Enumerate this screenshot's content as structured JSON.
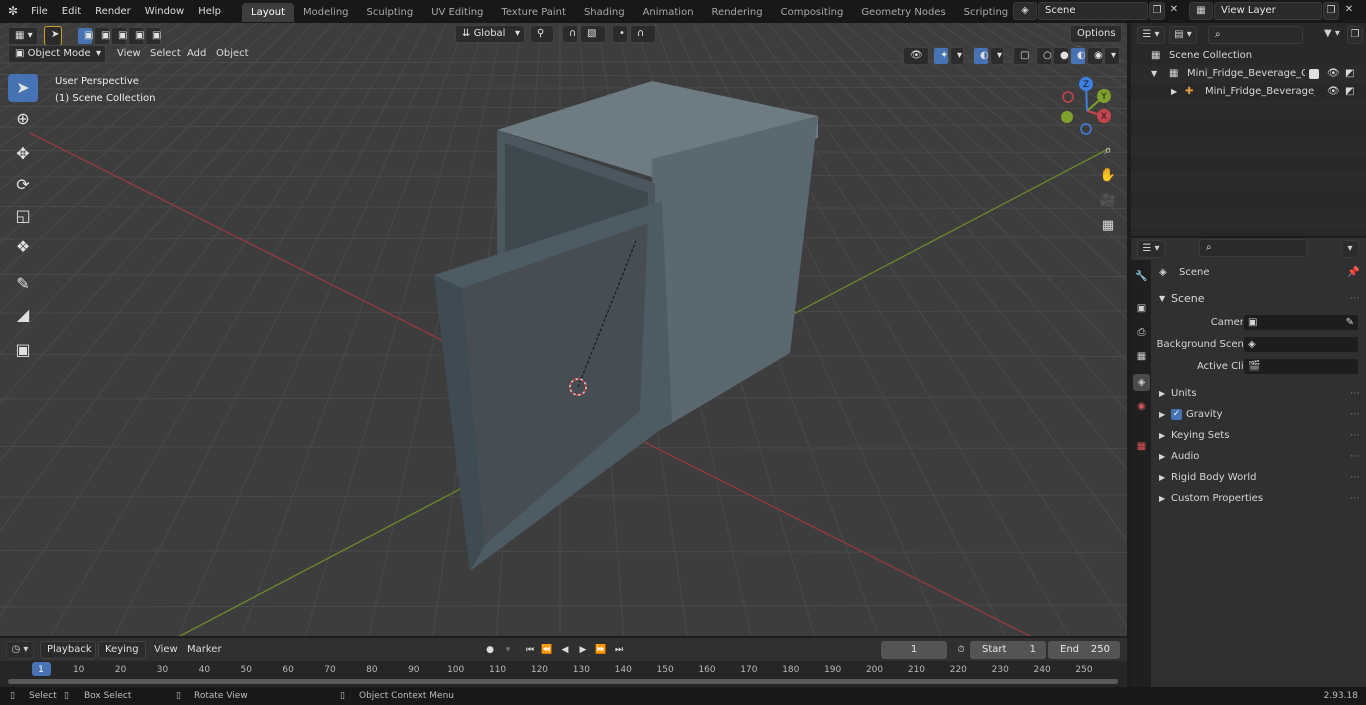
{
  "menu": [
    "File",
    "Edit",
    "Render",
    "Window",
    "Help"
  ],
  "workspaces": [
    "Layout",
    "Modeling",
    "Sculpting",
    "UV Editing",
    "Texture Paint",
    "Shading",
    "Animation",
    "Rendering",
    "Compositing",
    "Geometry Nodes",
    "Scripting"
  ],
  "active_workspace": "Layout",
  "scene_field": "Scene",
  "view_layer_field": "View Layer",
  "viewport": {
    "mode": "Object Mode",
    "menus": [
      "View",
      "Select",
      "Add",
      "Object"
    ],
    "transform_orientation": "Global",
    "options_label": "Options",
    "overlay_text_line1": "User Perspective",
    "overlay_text_line2": "(1) Scene Collection",
    "gizmo_axes": {
      "x": "X",
      "y": "Y",
      "z": "Z"
    }
  },
  "outliner": {
    "root": "Scene Collection",
    "collection": "Mini_Fridge_Beverage_Cooler",
    "object": "Mini_Fridge_Beverage_C"
  },
  "properties": {
    "context_title": "Scene",
    "panel_scene": "Scene",
    "camera_label": "Camera",
    "background_scene_label": "Background Scene",
    "active_clip_label": "Active Clip",
    "panels": [
      "Units",
      "Gravity",
      "Keying Sets",
      "Audio",
      "Rigid Body World",
      "Custom Properties"
    ],
    "gravity_checked": true
  },
  "timeline": {
    "menus": [
      "Playback",
      "Keying",
      "View",
      "Marker"
    ],
    "current_frame": "1",
    "start_label": "Start",
    "start_value": "1",
    "end_label": "End",
    "end_value": "250",
    "ruler_ticks": [
      "1",
      "10",
      "20",
      "30",
      "40",
      "50",
      "60",
      "70",
      "80",
      "90",
      "100",
      "110",
      "120",
      "130",
      "140",
      "150",
      "160",
      "170",
      "180",
      "190",
      "200",
      "210",
      "220",
      "230",
      "240",
      "250"
    ]
  },
  "status": {
    "select": "Select",
    "box_select": "Box Select",
    "rotate_view": "Rotate View",
    "context_menu": "Object Context Menu",
    "version": "2.93.18"
  },
  "colors": {
    "accent": "#4772b3",
    "x_axis": "#c5444d",
    "y_axis": "#7da22c",
    "z_axis": "#3d82e0"
  }
}
